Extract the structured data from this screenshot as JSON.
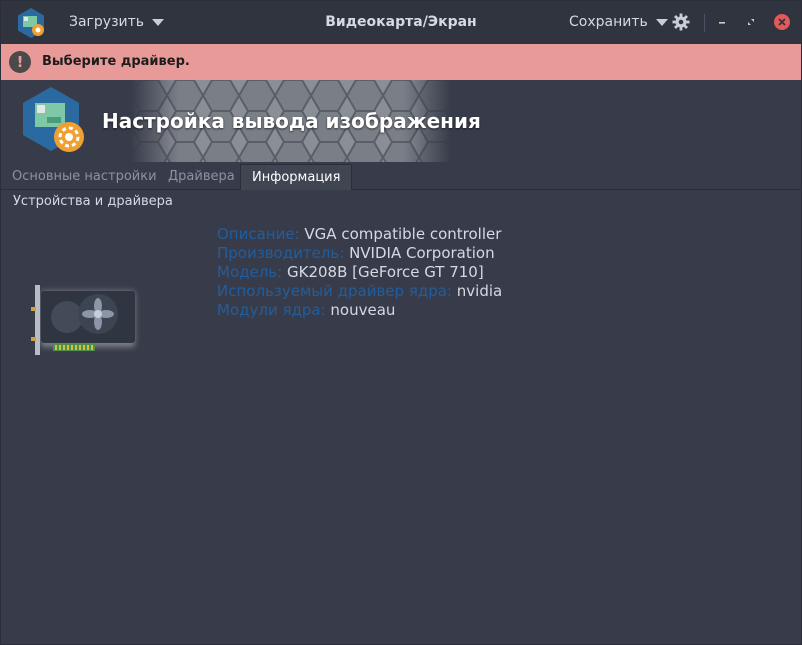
{
  "titlebar": {
    "load_label": "Загрузить",
    "title": "Видеокарта/Экран",
    "save_label": "Сохранить"
  },
  "alert": {
    "icon": "!",
    "text": "Выберите драйвер."
  },
  "banner": {
    "title": "Настройка вывода изображения"
  },
  "tabs": [
    {
      "label": "Основные настройки",
      "active": false
    },
    {
      "label": "Драйвера",
      "active": false
    },
    {
      "label": "Информация",
      "active": true
    }
  ],
  "section": {
    "label": "Устройства и драйвера"
  },
  "device_info": [
    {
      "key": "Описание:",
      "value": "VGA compatible controller"
    },
    {
      "key": "Производитель:",
      "value": "NVIDIA Corporation"
    },
    {
      "key": "Модель:",
      "value": "GK208B [GeForce GT 710]"
    },
    {
      "key": "Используемый драйвер ядра:",
      "value": "nvidia"
    },
    {
      "key": "Модули ядра:",
      "value": "nouveau"
    }
  ],
  "colors": {
    "accent_key": "#215d9c",
    "alert_bg": "#e89a98",
    "window_bg": "#383c4a",
    "close_button": "#e35a5a"
  }
}
